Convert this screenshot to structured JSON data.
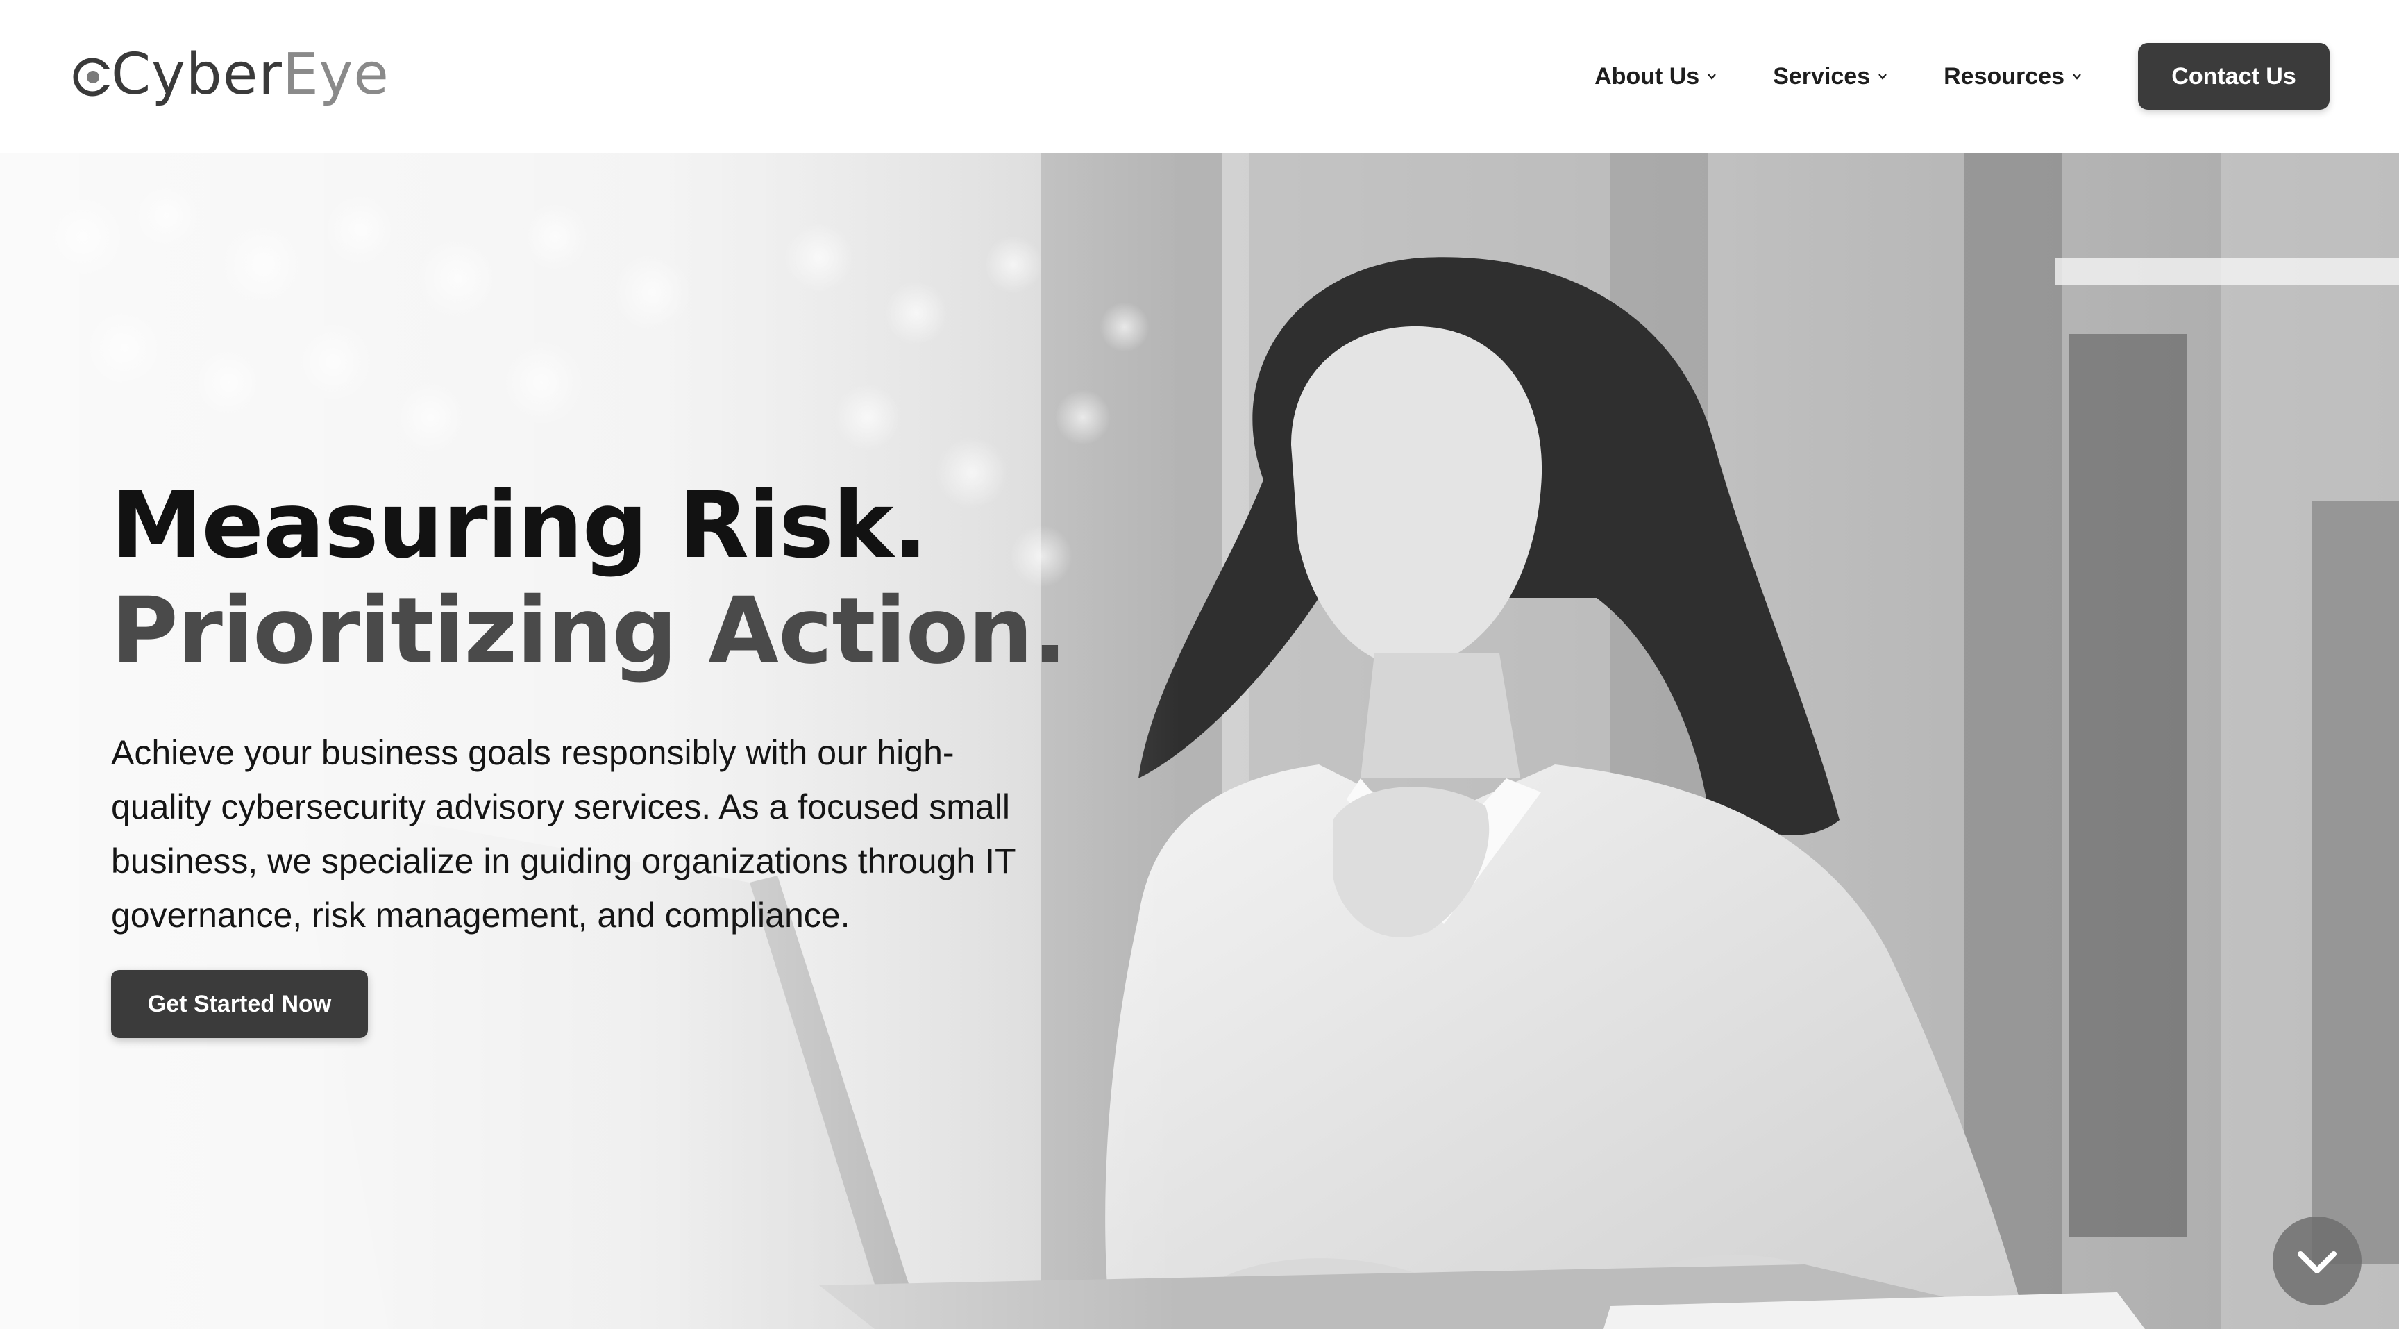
{
  "brand": {
    "name_part1": "Cyber",
    "name_part2": "Eye",
    "logo_icon": "eye-c-icon"
  },
  "nav": {
    "items": [
      {
        "label": "About Us",
        "icon": "chevron-down-icon"
      },
      {
        "label": "Services",
        "icon": "chevron-down-icon"
      },
      {
        "label": "Resources",
        "icon": "chevron-down-icon"
      }
    ],
    "contact_label": "Contact Us"
  },
  "hero": {
    "headline_line1": "Measuring Risk.",
    "headline_line2": "Prioritizing Action.",
    "body": "Achieve your business goals responsibly with our high-quality cybersecurity advisory services. As a focused small business, we specialize in guiding organizations through IT governance, risk management, and compliance.",
    "cta_label": "Get Started Now",
    "scroll_icon": "chevron-down-icon"
  },
  "colors": {
    "button_bg": "#3b3b3b",
    "button_text": "#ffffff",
    "headline_primary": "#121212",
    "headline_secondary": "#4a4a4a",
    "logo_light": "#8a8a8a"
  }
}
